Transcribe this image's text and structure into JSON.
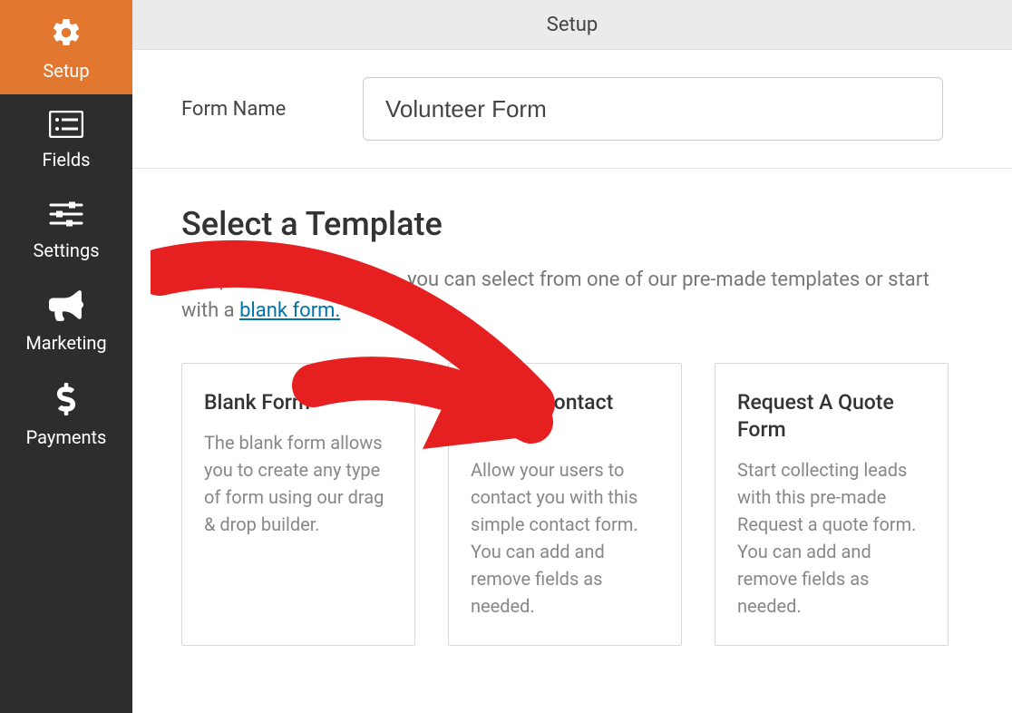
{
  "titlebar": "Setup",
  "sidebar": {
    "items": [
      {
        "label": "Setup"
      },
      {
        "label": "Fields"
      },
      {
        "label": "Settings"
      },
      {
        "label": "Marketing"
      },
      {
        "label": "Payments"
      }
    ]
  },
  "form_name": {
    "label": "Form Name",
    "value": "Volunteer Form"
  },
  "section": {
    "title": "Select a Template",
    "desc_before": "To speed up the process, you can select from one of our pre-made templates or start with a ",
    "desc_link": "blank form."
  },
  "templates": [
    {
      "title": "Blank Form",
      "desc": "The blank form allows you to create any type of form using our drag & drop builder."
    },
    {
      "title": "Simple Contact Form",
      "desc": "Allow your users to contact you with this simple contact form. You can add and remove fields as needed."
    },
    {
      "title": "Request A Quote Form",
      "desc": "Start collecting leads with this pre-made Request a quote form. You can add and remove fields as needed."
    }
  ]
}
